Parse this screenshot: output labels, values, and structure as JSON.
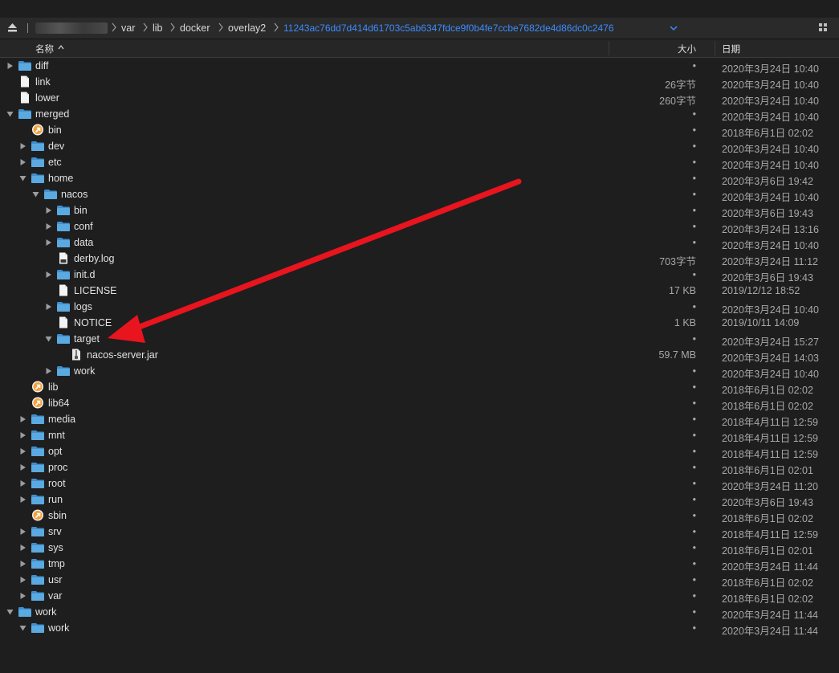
{
  "pathbar": {
    "crumbs": [
      "var",
      "lib",
      "docker",
      "overlay2"
    ],
    "current": "11243ac76dd7d414d61703c5ab6347fdce9f0b4fe7ccbe7682de4d86dc0c2476"
  },
  "columns": {
    "name": "名称",
    "size": "大小",
    "date": "日期"
  },
  "rows": [
    {
      "name": "diff",
      "type": "folder",
      "depth": 0,
      "expand": "closed",
      "size": "•",
      "date": "2020年3月24日 10:40"
    },
    {
      "name": "link",
      "type": "file",
      "depth": 0,
      "expand": "none",
      "size": "26字节",
      "date": "2020年3月24日 10:40"
    },
    {
      "name": "lower",
      "type": "file",
      "depth": 0,
      "expand": "none",
      "size": "260字节",
      "date": "2020年3月24日 10:40"
    },
    {
      "name": "merged",
      "type": "folder",
      "depth": 0,
      "expand": "open",
      "size": "•",
      "date": "2020年3月24日 10:40"
    },
    {
      "name": "bin",
      "type": "alias",
      "depth": 1,
      "expand": "none",
      "size": "•",
      "date": "2018年6月1日 02:02"
    },
    {
      "name": "dev",
      "type": "folder",
      "depth": 1,
      "expand": "closed",
      "size": "•",
      "date": "2020年3月24日 10:40"
    },
    {
      "name": "etc",
      "type": "folder",
      "depth": 1,
      "expand": "closed",
      "size": "•",
      "date": "2020年3月24日 10:40"
    },
    {
      "name": "home",
      "type": "folder",
      "depth": 1,
      "expand": "open",
      "size": "•",
      "date": "2020年3月6日 19:42"
    },
    {
      "name": "nacos",
      "type": "folder",
      "depth": 2,
      "expand": "open",
      "size": "•",
      "date": "2020年3月24日 10:40"
    },
    {
      "name": "bin",
      "type": "folder",
      "depth": 3,
      "expand": "closed",
      "size": "•",
      "date": "2020年3月6日 19:43"
    },
    {
      "name": "conf",
      "type": "folder",
      "depth": 3,
      "expand": "closed",
      "size": "•",
      "date": "2020年3月24日 13:16"
    },
    {
      "name": "data",
      "type": "folder",
      "depth": 3,
      "expand": "closed",
      "size": "•",
      "date": "2020年3月24日 10:40"
    },
    {
      "name": "derby.log",
      "type": "textfile",
      "depth": 3,
      "expand": "none",
      "size": "703字节",
      "date": "2020年3月24日 11:12"
    },
    {
      "name": "init.d",
      "type": "folder",
      "depth": 3,
      "expand": "closed",
      "size": "•",
      "date": "2020年3月6日 19:43"
    },
    {
      "name": "LICENSE",
      "type": "file",
      "depth": 3,
      "expand": "none",
      "size": "17 KB",
      "date": "2019/12/12 18:52"
    },
    {
      "name": "logs",
      "type": "folder",
      "depth": 3,
      "expand": "closed",
      "size": "•",
      "date": "2020年3月24日 10:40"
    },
    {
      "name": "NOTICE",
      "type": "file",
      "depth": 3,
      "expand": "none",
      "size": "1 KB",
      "date": "2019/10/11 14:09"
    },
    {
      "name": "target",
      "type": "folder",
      "depth": 3,
      "expand": "open",
      "size": "•",
      "date": "2020年3月24日 15:27"
    },
    {
      "name": "nacos-server.jar",
      "type": "jar",
      "depth": 4,
      "expand": "none",
      "size": "59.7 MB",
      "date": "2020年3月24日 14:03"
    },
    {
      "name": "work",
      "type": "folder",
      "depth": 3,
      "expand": "closed",
      "size": "•",
      "date": "2020年3月24日 10:40"
    },
    {
      "name": "lib",
      "type": "alias",
      "depth": 1,
      "expand": "none",
      "size": "•",
      "date": "2018年6月1日 02:02"
    },
    {
      "name": "lib64",
      "type": "alias",
      "depth": 1,
      "expand": "none",
      "size": "•",
      "date": "2018年6月1日 02:02"
    },
    {
      "name": "media",
      "type": "folder",
      "depth": 1,
      "expand": "closed",
      "size": "•",
      "date": "2018年4月11日 12:59"
    },
    {
      "name": "mnt",
      "type": "folder",
      "depth": 1,
      "expand": "closed",
      "size": "•",
      "date": "2018年4月11日 12:59"
    },
    {
      "name": "opt",
      "type": "folder",
      "depth": 1,
      "expand": "closed",
      "size": "•",
      "date": "2018年4月11日 12:59"
    },
    {
      "name": "proc",
      "type": "folder",
      "depth": 1,
      "expand": "closed",
      "size": "•",
      "date": "2018年6月1日 02:01"
    },
    {
      "name": "root",
      "type": "folder",
      "depth": 1,
      "expand": "closed",
      "size": "•",
      "date": "2020年3月24日 11:20"
    },
    {
      "name": "run",
      "type": "folder",
      "depth": 1,
      "expand": "closed",
      "size": "•",
      "date": "2020年3月6日 19:43"
    },
    {
      "name": "sbin",
      "type": "alias",
      "depth": 1,
      "expand": "none",
      "size": "•",
      "date": "2018年6月1日 02:02"
    },
    {
      "name": "srv",
      "type": "folder",
      "depth": 1,
      "expand": "closed",
      "size": "•",
      "date": "2018年4月11日 12:59"
    },
    {
      "name": "sys",
      "type": "folder",
      "depth": 1,
      "expand": "closed",
      "size": "•",
      "date": "2018年6月1日 02:01"
    },
    {
      "name": "tmp",
      "type": "folder",
      "depth": 1,
      "expand": "closed",
      "size": "•",
      "date": "2020年3月24日 11:44"
    },
    {
      "name": "usr",
      "type": "folder",
      "depth": 1,
      "expand": "closed",
      "size": "•",
      "date": "2018年6月1日 02:02"
    },
    {
      "name": "var",
      "type": "folder",
      "depth": 1,
      "expand": "closed",
      "size": "•",
      "date": "2018年6月1日 02:02"
    },
    {
      "name": "work",
      "type": "folder",
      "depth": 0,
      "expand": "open",
      "size": "•",
      "date": "2020年3月24日 11:44"
    },
    {
      "name": "work",
      "type": "folder",
      "depth": 1,
      "expand": "open",
      "size": "•",
      "date": "2020年3月24日 11:44"
    }
  ],
  "colors": {
    "accent": "#3b8cff",
    "folder": "#5aa9e0",
    "annotation_arrow": "#e8141e"
  },
  "icons": {
    "eject": "eject-icon",
    "view": "grid-view-icon",
    "folder": "folder-icon",
    "file": "document-icon",
    "alias": "alias-icon",
    "jar": "jar-file-icon"
  }
}
